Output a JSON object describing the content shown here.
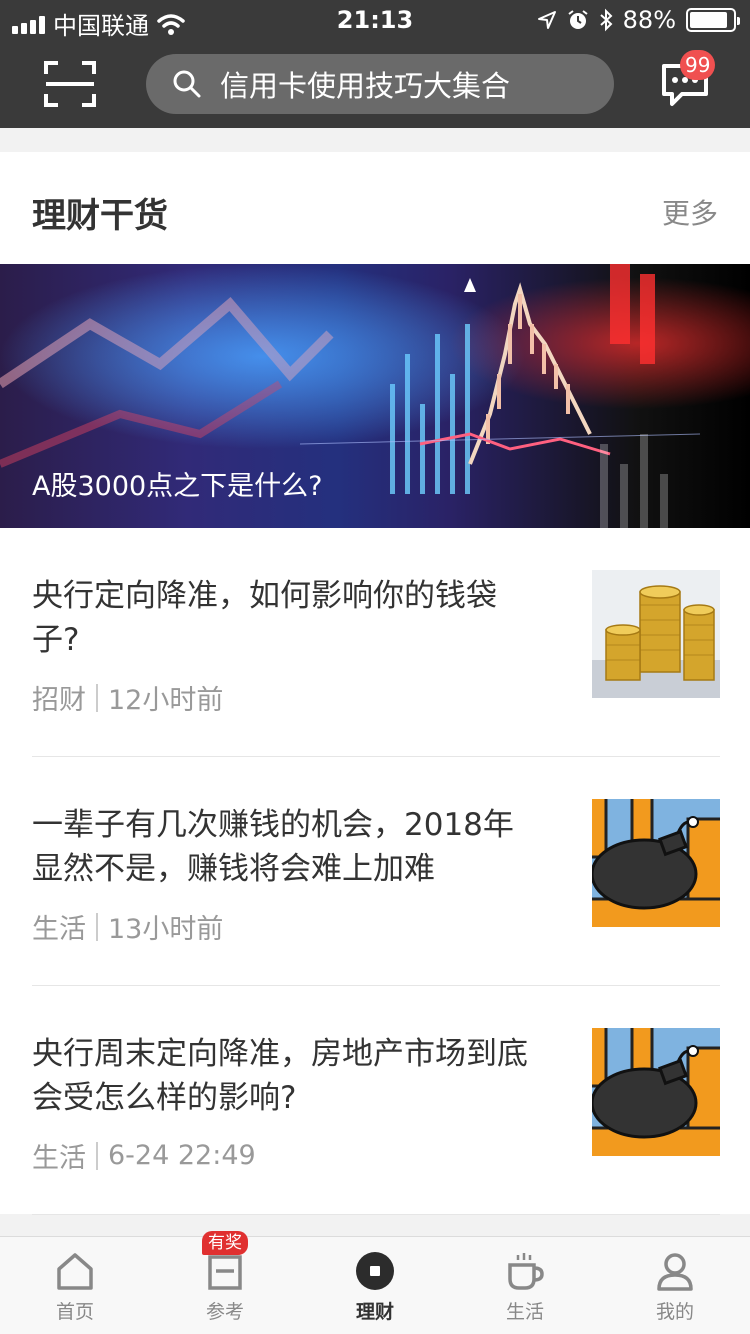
{
  "status_bar": {
    "carrier": "中国联通",
    "time": "21:13",
    "battery_percent": "88%",
    "battery_level": 0.88,
    "icons": [
      "signal-icon",
      "wifi-icon",
      "location-icon",
      "alarm-icon",
      "bluetooth-icon",
      "battery-icon"
    ]
  },
  "header": {
    "search_placeholder": "信用卡使用技巧大集合",
    "message_badge": "99",
    "icons": [
      "scan-icon",
      "search-icon",
      "message-icon"
    ],
    "bg_color": "#3a3a3a"
  },
  "section": {
    "title": "理财干货",
    "more_label": "更多"
  },
  "banner": {
    "caption": "A股3000点之下是什么?"
  },
  "articles": [
    {
      "title": "央行定向降准，如何影响你的钱袋子?",
      "category": "招财",
      "time": "12小时前",
      "thumb": "gold-coins-image"
    },
    {
      "title": "一辈子有几次赚钱的机会，2018年显然不是，赚钱将会难上加难",
      "category": "生活",
      "time": "13小时前",
      "thumb": "bomb-image"
    },
    {
      "title": "央行周末定向降准，房地产市场到底会受怎么样的影响?",
      "category": "生活",
      "time": "6-24 22:49",
      "thumb": "bomb-image"
    }
  ],
  "tabbar": {
    "tabs": [
      {
        "label": "首页",
        "icon": "home-icon"
      },
      {
        "label": "参考",
        "icon": "reference-icon",
        "badge": "有奖"
      },
      {
        "label": "理财",
        "icon": "finance-icon",
        "active": true
      },
      {
        "label": "生活",
        "icon": "coffee-icon"
      },
      {
        "label": "我的",
        "icon": "profile-icon"
      }
    ]
  },
  "colors": {
    "badge_red": "#f05050",
    "accent_dark": "#333333"
  }
}
